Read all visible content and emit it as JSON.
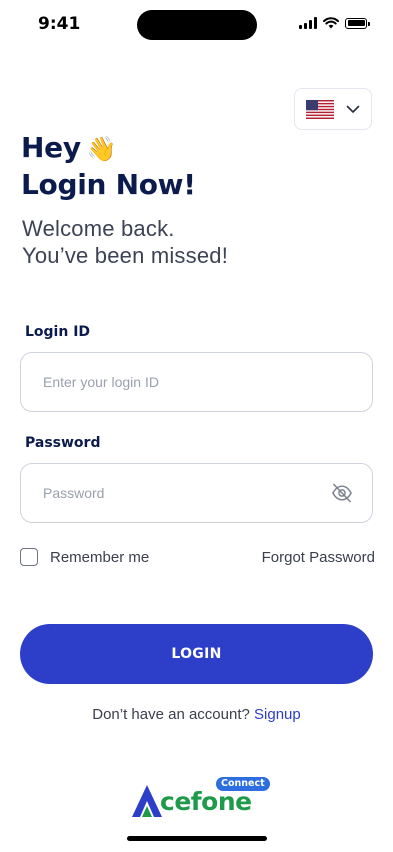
{
  "status_bar": {
    "time": "9:41"
  },
  "language": {
    "flag": "us-flag-icon"
  },
  "header": {
    "greeting_line1": "Hey",
    "wave_emoji": "👋",
    "greeting_line2": "Login Now!",
    "subtitle_line1": "Welcome back.",
    "subtitle_line2": "You’ve been missed!"
  },
  "form": {
    "login_id_label": "Login ID",
    "login_id_placeholder": "Enter your login ID",
    "login_id_value": "",
    "password_label": "Password",
    "password_placeholder": "Password",
    "password_value": "",
    "remember_label": "Remember me",
    "forgot_label": "Forgot Password",
    "login_button": "LOGIN"
  },
  "signup": {
    "prompt": "Don’t have an account?",
    "link": "Signup"
  },
  "brand": {
    "badge": "Connect",
    "wordmark": "cefone",
    "primary_color": "#2d3ec9",
    "green_color": "#1f9a4a"
  }
}
